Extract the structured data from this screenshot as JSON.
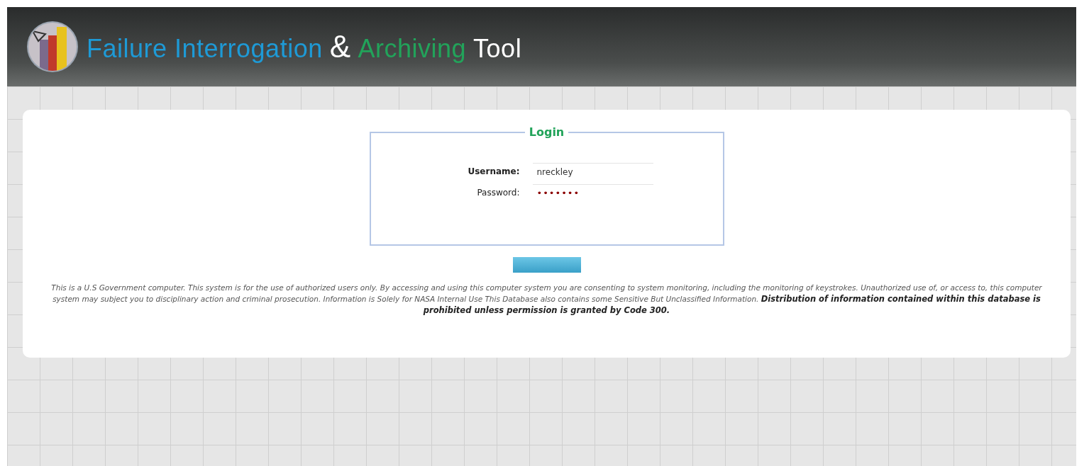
{
  "header": {
    "title_parts": [
      {
        "text": "Failure Interrogation",
        "color": "#1e9ad6"
      },
      {
        "text": "&",
        "color": "#ffffff"
      },
      {
        "text": "Archiving",
        "color": "#22a35a"
      },
      {
        "text": "Tool",
        "color": "#ffffff"
      }
    ]
  },
  "login": {
    "legend": "Login",
    "fields": [
      {
        "label": "Username:",
        "kind": "text",
        "value": "nreckley"
      },
      {
        "label": "Password:",
        "kind": "password",
        "value": "•••••••"
      }
    ],
    "button": {
      "kind": "submit"
    }
  },
  "notice": "This is a U.S Government computer. This system is for the use of authorized users only. By accessing and using this computer system you are consenting to system monitoring, including the monitoring of keystrokes. Unauthorized use of, or access to, this computer system may subject you to disciplinary action and criminal prosecution. Information is Solely for NASA Internal Use This Database also contains some Sensitive But Unclassified Information. **Distribution of information contained within this database is prohibited unless permission is granted by Code 300.**"
}
